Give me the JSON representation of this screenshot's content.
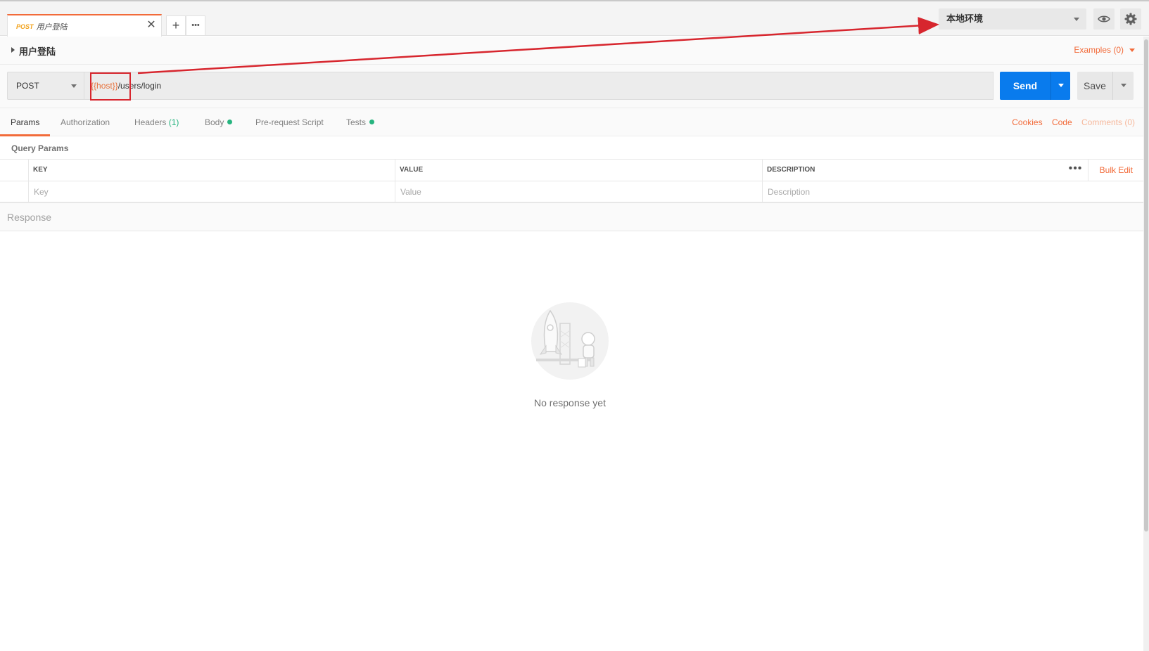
{
  "tab": {
    "method": "POST",
    "name": "用户登陆",
    "close": "✕"
  },
  "toolbar": {
    "new_tab": "+",
    "more": "•••"
  },
  "environment": {
    "selected": "本地环境"
  },
  "request": {
    "title": "用户登陆",
    "examples": "Examples (0)",
    "method": "POST",
    "url_var": "{{host}}",
    "url_path": "/users/login",
    "send": "Send",
    "save": "Save"
  },
  "req_tabs": {
    "params": "Params",
    "authorization": "Authorization",
    "headers": "Headers",
    "headers_count": "(1)",
    "body": "Body",
    "prerequest": "Pre-request Script",
    "tests": "Tests",
    "cookies": "Cookies",
    "code": "Code",
    "comments": "Comments (0)"
  },
  "query_params": {
    "title": "Query Params",
    "columns": [
      "KEY",
      "VALUE",
      "DESCRIPTION"
    ],
    "more": "•••",
    "bulk_edit": "Bulk Edit",
    "placeholders": [
      "Key",
      "Value",
      "Description"
    ]
  },
  "response": {
    "label": "Response",
    "empty_text": "No response yet"
  },
  "colors": {
    "accent": "#f26b3a",
    "send": "#097bed",
    "annotation": "#d7262e",
    "success": "#26b47f"
  }
}
